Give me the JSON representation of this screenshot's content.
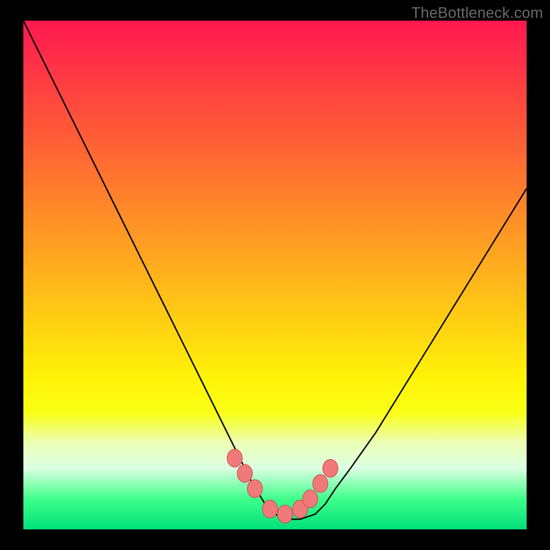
{
  "watermark": {
    "text": "TheBottleneck.com"
  },
  "colors": {
    "curve_stroke": "#000000",
    "bead_fill": "#f07a7a",
    "bead_stroke": "#c94d4d"
  },
  "chart_data": {
    "type": "line",
    "title": "",
    "xlabel": "",
    "ylabel": "",
    "xlim": [
      0,
      100
    ],
    "ylim": [
      0,
      100
    ],
    "grid": false,
    "legend": false,
    "series": [
      {
        "name": "bottleneck-curve",
        "x": [
          0,
          5,
          10,
          15,
          20,
          25,
          30,
          35,
          40,
          45,
          48,
          50,
          52,
          55,
          58,
          60,
          62,
          65,
          70,
          75,
          80,
          85,
          90,
          95,
          100
        ],
        "values": [
          100,
          90,
          80,
          70,
          60,
          50,
          40,
          30,
          20,
          10,
          5,
          3,
          2,
          2,
          3,
          5,
          8,
          12,
          19,
          27,
          35,
          43,
          51,
          59,
          67
        ]
      }
    ],
    "markers": {
      "name": "beads",
      "x": [
        42,
        44,
        46,
        49,
        52,
        55,
        57,
        59,
        61
      ],
      "values": [
        14,
        11,
        8,
        4,
        3,
        4,
        6,
        9,
        12
      ]
    }
  }
}
